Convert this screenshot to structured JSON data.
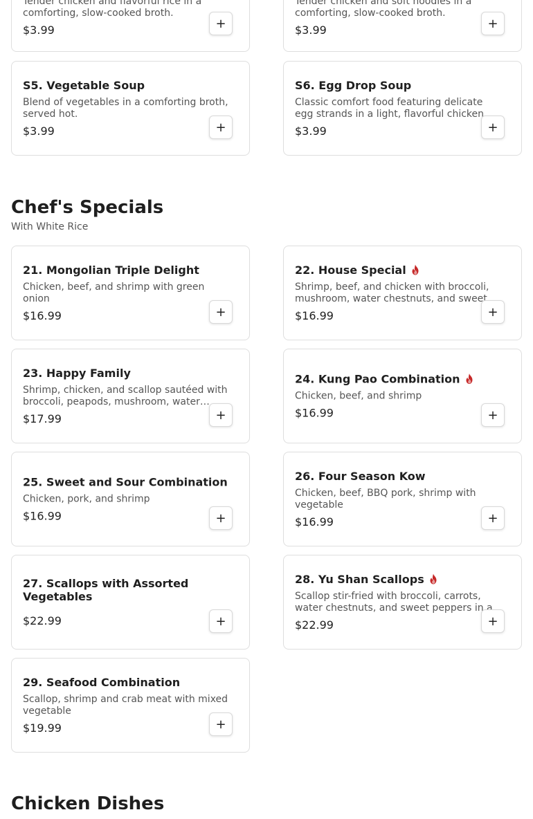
{
  "top_cards": [
    {
      "desc": "Tender chicken and flavorful rice in a comforting, slow-cooked broth.",
      "price": "$3.99"
    },
    {
      "desc": "Tender chicken and soft noodles in a comforting, slow-cooked broth.",
      "price": "$3.99"
    }
  ],
  "soups": [
    {
      "title": "S5. Vegetable Soup",
      "desc": "Blend of vegetables in a comforting broth, served hot.",
      "price": "$3.99"
    },
    {
      "title": "S6. Egg Drop Soup",
      "desc": "Classic comfort food featuring delicate egg strands in a light, flavorful chicken broth.",
      "price": "$3.99"
    }
  ],
  "chefs_specials": {
    "title": "Chef's Specials",
    "subtitle": "With White Rice",
    "items": [
      {
        "title": "21. Mongolian Triple Delight",
        "desc": "Chicken, beef, and shrimp with green onion",
        "price": "$16.99",
        "spicy": false
      },
      {
        "title": "22. House Special",
        "desc": "Shrimp, beef, and chicken with broccoli, mushroom, water chestnuts, and sweet peppers",
        "price": "$16.99",
        "spicy": true
      },
      {
        "title": "23. Happy Family",
        "desc": "Shrimp, chicken, and scallop sautéed with broccoli, peapods, mushroom, water chestnuts",
        "price": "$17.99",
        "spicy": false
      },
      {
        "title": "24. Kung Pao Combination",
        "desc": "Chicken, beef, and shrimp",
        "price": "$16.99",
        "spicy": true
      },
      {
        "title": "25. Sweet and Sour Combination",
        "desc": "Chicken, pork, and shrimp",
        "price": "$16.99",
        "spicy": false
      },
      {
        "title": "26. Four Season Kow",
        "desc": "Chicken, beef, BBQ pork, shrimp with vegetable",
        "price": "$16.99",
        "spicy": false
      },
      {
        "title": "27. Scallops with Assorted Vegetables",
        "desc": "",
        "price": "$22.99",
        "spicy": false
      },
      {
        "title": "28. Yu Shan Scallops",
        "desc": "Scallop stir-fried with broccoli, carrots, water chestnuts, and sweet peppers in a spicy sauce",
        "price": "$22.99",
        "spicy": true
      },
      {
        "title": "29. Seafood Combination",
        "desc": "Scallop, shrimp and crab meat with mixed vegetable",
        "price": "$19.99",
        "spicy": false
      }
    ]
  },
  "chicken_dishes": {
    "title": "Chicken Dishes"
  },
  "add_button_label": "+",
  "icons": {
    "add": "plus-icon",
    "spicy": "flame-icon"
  },
  "colors": {
    "spicy": "#c62828",
    "border": "#dedede"
  }
}
